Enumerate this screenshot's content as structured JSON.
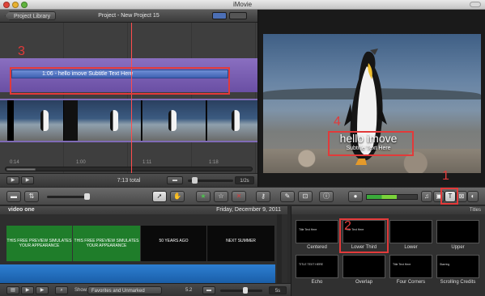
{
  "window": {
    "title": "iMovie"
  },
  "project": {
    "back_label": "Project Library",
    "title": "Project - New Project 15",
    "total": "7:13 total",
    "zoom": "1/2s",
    "ruler_ticks": [
      "0:14",
      "1:00",
      "1:11",
      "1:18"
    ]
  },
  "timeline": {
    "title_clip_label": "1:06 - hello imove Subtitle Text Here"
  },
  "viewer": {
    "subtitle_main": "hello imove",
    "subtitle_small": "Subtitle Text Here"
  },
  "annotations": {
    "n1": "1",
    "n2": "2",
    "n3": "3",
    "n4": "4"
  },
  "event": {
    "name": "video one",
    "date": "Friday, December 9, 2011",
    "clips": [
      {
        "text": "THIS FREE PREVIEW SIMULATES YOUR APPEARANCE"
      },
      {
        "text": "THIS FREE PREVIEW SIMULATES YOUR APPEARANCE"
      },
      {
        "text": "50 YEARS AGO"
      },
      {
        "text": "NEXT SUMMER"
      }
    ]
  },
  "titles": {
    "header": "Titles",
    "items": [
      {
        "label": "Centered",
        "preview": "Title Text Here"
      },
      {
        "label": "Lower Third",
        "preview": "Title Text Here"
      },
      {
        "label": "Lower",
        "preview": ""
      },
      {
        "label": "Upper",
        "preview": ""
      },
      {
        "label": "Echo",
        "preview": "TITLE TEXT HERE"
      },
      {
        "label": "Overlap",
        "preview": ""
      },
      {
        "label": "Four Corners",
        "preview": "Title Text Here"
      },
      {
        "label": "Scrolling Credits",
        "preview": "Starring"
      }
    ]
  },
  "footer": {
    "show_label": "Show:",
    "show_value": "Favorites and Unmarked",
    "count": "5.2",
    "seconds": "5s"
  },
  "colors": {
    "annotation": "#e23a3a",
    "title_track": "#7a5fb4",
    "playhead": "#ff4d4d"
  }
}
